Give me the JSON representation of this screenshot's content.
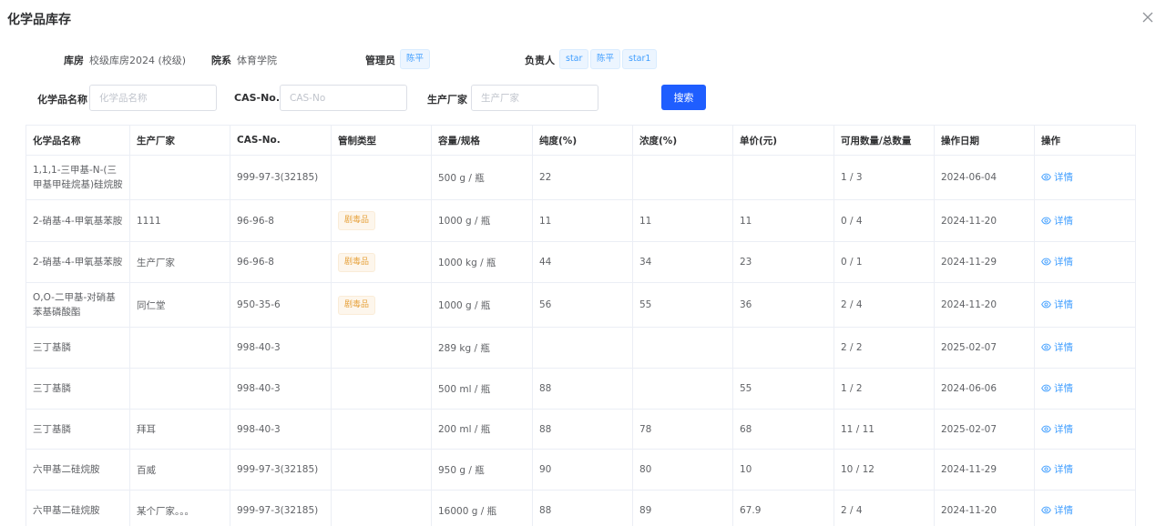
{
  "modal": {
    "title": "化学品库存"
  },
  "info": {
    "warehouse_label": "库房",
    "warehouse_value": "校级库房2024 (校级)",
    "department_label": "院系",
    "department_value": "体育学院",
    "admin_label": "管理员",
    "admin_tags": [
      "陈平"
    ],
    "owner_label": "负责人",
    "owner_tags": [
      "star",
      "陈平",
      "star1"
    ]
  },
  "search": {
    "name_label": "化学品名称",
    "name_placeholder": "化学品名称",
    "cas_label": "CAS-No.",
    "cas_placeholder": "CAS-No",
    "maker_label": "生产厂家",
    "maker_placeholder": "生产厂家",
    "button_label": "搜索"
  },
  "table": {
    "columns": [
      "化学品名称",
      "生产厂家",
      "CAS-No.",
      "管制类型",
      "容量/规格",
      "纯度(%)",
      "浓度(%)",
      "单价(元)",
      "可用数量/总数量",
      "操作日期",
      "操作"
    ],
    "detail_label": "详情",
    "rows": [
      {
        "name": "1,1,1-三甲基-N-(三甲基甲硅烷基)硅烷胺",
        "maker": "",
        "cas": "999-97-3(32185)",
        "control": "",
        "spec": "500 g / 瓶",
        "purity": "22",
        "conc": "",
        "price": "",
        "qty": "1 / 3",
        "date": "2024-06-04"
      },
      {
        "name": "2-硝基-4-甲氧基苯胺",
        "maker": "1111",
        "cas": "96-96-8",
        "control": "剧毒品",
        "spec": "1000 g / 瓶",
        "purity": "11",
        "conc": "11",
        "price": "11",
        "qty": "0 / 4",
        "date": "2024-11-20"
      },
      {
        "name": "2-硝基-4-甲氧基苯胺",
        "maker": "生产厂家",
        "cas": "96-96-8",
        "control": "剧毒品",
        "spec": "1000 kg / 瓶",
        "purity": "44",
        "conc": "34",
        "price": "23",
        "qty": "0 / 1",
        "date": "2024-11-29"
      },
      {
        "name": "O,O-二甲基-对硝基苯基磷酸酯",
        "maker": "同仁堂",
        "cas": "950-35-6",
        "control": "剧毒品",
        "spec": "1000 g / 瓶",
        "purity": "56",
        "conc": "55",
        "price": "36",
        "qty": "2 / 4",
        "date": "2024-11-20"
      },
      {
        "name": "三丁基膦",
        "maker": "",
        "cas": "998-40-3",
        "control": "",
        "spec": "289 kg / 瓶",
        "purity": "",
        "conc": "",
        "price": "",
        "qty": "2 / 2",
        "date": "2025-02-07"
      },
      {
        "name": "三丁基膦",
        "maker": "",
        "cas": "998-40-3",
        "control": "",
        "spec": "500 ml / 瓶",
        "purity": "88",
        "conc": "",
        "price": "55",
        "qty": "1 / 2",
        "date": "2024-06-06"
      },
      {
        "name": "三丁基膦",
        "maker": "拜耳",
        "cas": "998-40-3",
        "control": "",
        "spec": "200 ml / 瓶",
        "purity": "88",
        "conc": "78",
        "price": "68",
        "qty": "11 / 11",
        "date": "2025-02-07"
      },
      {
        "name": "六甲基二硅烷胺",
        "maker": "百威",
        "cas": "999-97-3(32185)",
        "control": "",
        "spec": "950 g / 瓶",
        "purity": "90",
        "conc": "80",
        "price": "10",
        "qty": "10 / 12",
        "date": "2024-11-29"
      },
      {
        "name": "六甲基二硅烷胺",
        "maker": "某个厂家。。。",
        "cas": "999-97-3(32185)",
        "control": "",
        "spec": "16000 g / 瓶",
        "purity": "88",
        "conc": "89",
        "price": "67.9",
        "qty": "2 / 4",
        "date": "2024-11-20"
      }
    ]
  }
}
